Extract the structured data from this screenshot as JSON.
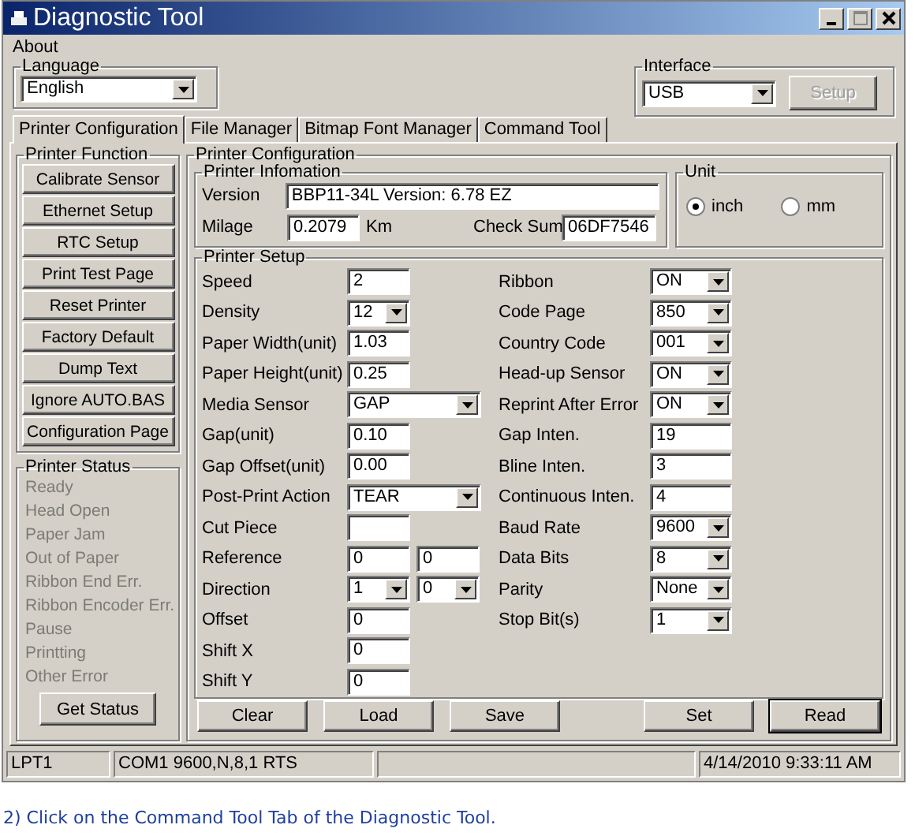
{
  "window": {
    "title": "Diagnostic Tool"
  },
  "menu": [
    "About"
  ],
  "language": {
    "label": "Language",
    "value": "English"
  },
  "interface": {
    "label": "Interface",
    "value": "USB"
  },
  "setup_button": {
    "label": "Setup",
    "disabled": true
  },
  "tabs": [
    {
      "label": "Printer Configuration",
      "selected": true
    },
    {
      "label": "File Manager",
      "selected": false
    },
    {
      "label": "Bitmap Font Manager",
      "selected": false
    },
    {
      "label": "Command Tool",
      "selected": false
    }
  ],
  "printer_function": {
    "title": "Printer Function",
    "buttons": [
      "Calibrate Sensor",
      "Ethernet Setup",
      "RTC Setup",
      "Print Test Page",
      "Reset Printer",
      "Factory Default",
      "Dump Text",
      "Ignore AUTO.BAS",
      "Configuration Page"
    ]
  },
  "printer_status": {
    "title": "Printer Status",
    "items": [
      {
        "label": "Ready",
        "disabled": true
      },
      {
        "label": "Head Open",
        "disabled": true
      },
      {
        "label": "Paper Jam",
        "disabled": true
      },
      {
        "label": "Out of Paper",
        "disabled": true
      },
      {
        "label": "Ribbon End Err.",
        "disabled": true
      },
      {
        "label": "Ribbon Encoder Err.",
        "disabled": true
      },
      {
        "label": "Pause",
        "disabled": true
      },
      {
        "label": "Printting",
        "disabled": true
      },
      {
        "label": "Other Error",
        "disabled": true
      }
    ],
    "button": "Get Status"
  },
  "printer_configuration": {
    "title": "Printer Configuration",
    "printer_information": {
      "title": "Printer Infomation",
      "version_label": "Version",
      "version": "BBP11-34L Version: 6.78 EZ",
      "milage_label": "Milage",
      "milage": "0.2079",
      "milage_unit": "Km",
      "check_sum_label": "Check Sum",
      "check_sum": "06DF7546"
    },
    "unit": {
      "title": "Unit",
      "options": [
        {
          "label": "inch",
          "selected": true
        },
        {
          "label": "mm",
          "selected": false
        }
      ]
    },
    "printer_setup": {
      "title": "Printer Setup",
      "left": [
        {
          "label": "Speed",
          "controls": [
            {
              "kind": "text",
              "value": "2"
            }
          ]
        },
        {
          "label": "Density",
          "controls": [
            {
              "kind": "select",
              "value": "12"
            }
          ]
        },
        {
          "label": "Paper Width(unit)",
          "controls": [
            {
              "kind": "text",
              "value": "1.03"
            }
          ]
        },
        {
          "label": "Paper Height(unit)",
          "controls": [
            {
              "kind": "text",
              "value": "0.25"
            }
          ]
        },
        {
          "label": "Media Sensor",
          "controls": [
            {
              "kind": "wideselect",
              "value": "GAP"
            }
          ]
        },
        {
          "label": "Gap(unit)",
          "controls": [
            {
              "kind": "text",
              "value": "0.10"
            }
          ]
        },
        {
          "label": "Gap Offset(unit)",
          "controls": [
            {
              "kind": "text",
              "value": "0.00"
            }
          ]
        },
        {
          "label": "Post-Print Action",
          "controls": [
            {
              "kind": "wideselect",
              "value": "TEAR"
            }
          ]
        },
        {
          "label": "Cut Piece",
          "controls": [
            {
              "kind": "text"
            }
          ]
        },
        {
          "label": "Reference",
          "controls": [
            {
              "kind": "text",
              "value": "0"
            },
            {
              "kind": "text",
              "value": "0"
            }
          ]
        },
        {
          "label": "Direction",
          "controls": [
            {
              "kind": "select",
              "value": "1"
            },
            {
              "kind": "select",
              "value": "0"
            }
          ]
        },
        {
          "label": "Offset",
          "controls": [
            {
              "kind": "text",
              "value": "0"
            }
          ]
        },
        {
          "label": "Shift X",
          "controls": [
            {
              "kind": "text",
              "value": "0"
            }
          ]
        },
        {
          "label": "Shift Y",
          "controls": [
            {
              "kind": "text",
              "value": "0"
            }
          ]
        }
      ],
      "right": [
        {
          "label": "Ribbon",
          "controls": [
            {
              "kind": "select",
              "value": "ON"
            }
          ]
        },
        {
          "label": "Code Page",
          "controls": [
            {
              "kind": "select",
              "value": "850"
            }
          ]
        },
        {
          "label": "Country Code",
          "controls": [
            {
              "kind": "select",
              "value": "001"
            }
          ]
        },
        {
          "label": "Head-up Sensor",
          "controls": [
            {
              "kind": "select",
              "value": "ON"
            }
          ]
        },
        {
          "label": "Reprint After Error",
          "controls": [
            {
              "kind": "select",
              "value": "ON"
            }
          ]
        },
        {
          "label": "Gap Inten.",
          "controls": [
            {
              "kind": "text",
              "value": "19"
            }
          ]
        },
        {
          "label": "Bline Inten.",
          "controls": [
            {
              "kind": "text",
              "value": "3"
            }
          ]
        },
        {
          "label": "Continuous Inten.",
          "controls": [
            {
              "kind": "text",
              "value": "4"
            }
          ]
        },
        {
          "label": "Baud Rate",
          "controls": [
            {
              "kind": "select",
              "value": "9600"
            }
          ]
        },
        {
          "label": "Data Bits",
          "controls": [
            {
              "kind": "select",
              "value": "8"
            }
          ]
        },
        {
          "label": "Parity",
          "controls": [
            {
              "kind": "select",
              "value": "None"
            }
          ]
        },
        {
          "label": "Stop Bit(s)",
          "controls": [
            {
              "kind": "select",
              "value": "1"
            }
          ]
        }
      ]
    },
    "buttons": [
      {
        "label": "Clear",
        "default": false
      },
      {
        "label": "Load",
        "default": false
      },
      {
        "label": "Save",
        "default": false
      },
      {
        "label": "Set",
        "default": false
      },
      {
        "label": "Read",
        "default": true
      }
    ]
  },
  "status_bar": {
    "port": "LPT1",
    "com": "COM1 9600,N,8,1 RTS",
    "datetime": "4/14/2010 9:33:11 AM"
  },
  "caption": "2) Click on the Command Tool Tab of the Diagnostic Tool."
}
